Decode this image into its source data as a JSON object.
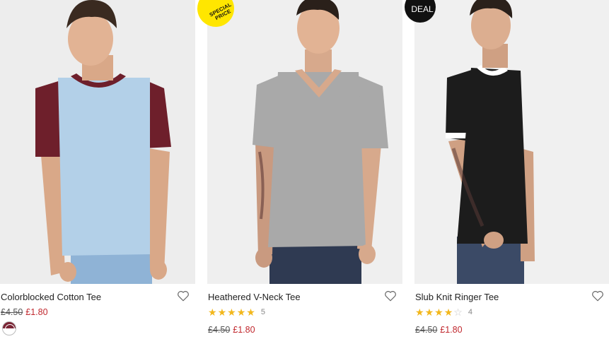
{
  "products": [
    {
      "title": "Colorblocked Cotton Tee",
      "price_old": "£4.50",
      "price_new": "£1.80",
      "badge": "",
      "rating": null,
      "review_count": "",
      "swatch_colors": [
        "#7a2434",
        "#ffffff"
      ],
      "image_colors": {
        "body": "#b3d0e8",
        "sleeves": "#6e1f2b",
        "collar": "#6e1f2b",
        "pants": "#8fb3d6"
      }
    },
    {
      "title": "Heathered V-Neck Tee",
      "price_old": "£4.50",
      "price_new": "£1.80",
      "badge": "SPECIAL PRICE",
      "rating": 5,
      "review_count": "5",
      "image_colors": {
        "body": "#a9a9a9",
        "sleeves": "#a9a9a9",
        "pants": "#2f3a52"
      }
    },
    {
      "title": "Slub Knit Ringer Tee",
      "price_old": "£4.50",
      "price_new": "£1.80",
      "badge": "DEAL",
      "rating": 4,
      "review_count": "4",
      "image_colors": {
        "body": "#1c1c1c",
        "sleeves": "#1c1c1c",
        "trim": "#ffffff",
        "pants": "#3b4a66"
      }
    }
  ],
  "icons": {
    "wishlist": "heart-outline-icon",
    "star_filled": "★",
    "star_empty": "☆"
  },
  "colors": {
    "sale_price": "#c0272d",
    "star": "#f2b71c",
    "special_badge": "#ffe600",
    "deal_badge": "#111111"
  }
}
